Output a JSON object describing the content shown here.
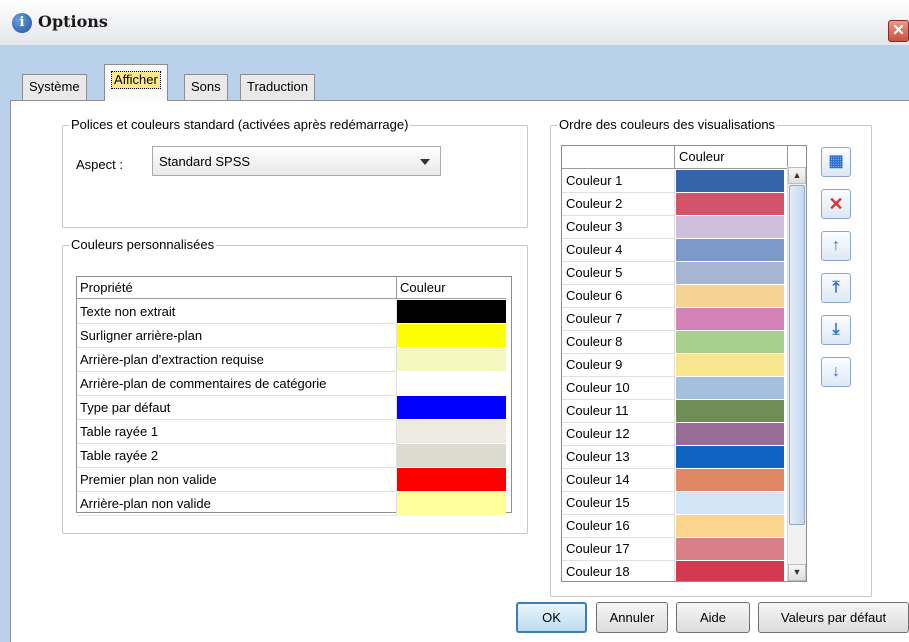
{
  "window": {
    "title": "Options",
    "close_glyph": "✕",
    "logo_glyph": "i"
  },
  "tabs": [
    {
      "label": "Système",
      "active": false
    },
    {
      "label": "Afficher",
      "active": true
    },
    {
      "label": "Sons",
      "active": false
    },
    {
      "label": "Traduction",
      "active": false
    }
  ],
  "fonts_group": {
    "legend": "Polices et couleurs standard (activées après redémarrage)",
    "aspect_label": "Aspect :",
    "aspect_value": "Standard SPSS"
  },
  "custom_colors": {
    "legend": "Couleurs personnalisées",
    "headers": {
      "property": "Propriété",
      "color": "Couleur"
    },
    "rows": [
      {
        "label": "Texte non extrait",
        "color": "#000000"
      },
      {
        "label": "Surligner arrière-plan",
        "color": "#ffff00"
      },
      {
        "label": "Arrière-plan d'extraction requise",
        "color": "#f5f7c0"
      },
      {
        "label": "Arrière-plan de commentaires de catégorie",
        "color": "#ffffff"
      },
      {
        "label": "Type par défaut",
        "color": "#0000ff"
      },
      {
        "label": "Table rayée 1",
        "color": "#eceae1"
      },
      {
        "label": "Table rayée 2",
        "color": "#dcdbd0"
      },
      {
        "label": "Premier plan non valide",
        "color": "#ff0000"
      },
      {
        "label": "Arrière-plan non valide",
        "color": "#ffff99"
      }
    ]
  },
  "viz_order": {
    "legend": "Ordre des couleurs des visualisations",
    "header_color": "Couleur",
    "rows": [
      {
        "label": "Couleur 1",
        "color": "#3465aa"
      },
      {
        "label": "Couleur 2",
        "color": "#d3536b"
      },
      {
        "label": "Couleur 3",
        "color": "#cfbfdd"
      },
      {
        "label": "Couleur 4",
        "color": "#7d99c9"
      },
      {
        "label": "Couleur 5",
        "color": "#a6b6d2"
      },
      {
        "label": "Couleur 6",
        "color": "#f5d394"
      },
      {
        "label": "Couleur 7",
        "color": "#d583b6"
      },
      {
        "label": "Couleur 8",
        "color": "#a8cf8d"
      },
      {
        "label": "Couleur 9",
        "color": "#f8e68f"
      },
      {
        "label": "Couleur 10",
        "color": "#a4c0dd"
      },
      {
        "label": "Couleur 11",
        "color": "#708d55"
      },
      {
        "label": "Couleur 12",
        "color": "#976d95"
      },
      {
        "label": "Couleur 13",
        "color": "#0f64c2"
      },
      {
        "label": "Couleur 14",
        "color": "#df8866"
      },
      {
        "label": "Couleur 15",
        "color": "#d4e4f7"
      },
      {
        "label": "Couleur 16",
        "color": "#fbd58d"
      },
      {
        "label": "Couleur 17",
        "color": "#d87f8a"
      },
      {
        "label": "Couleur 18",
        "color": "#d23a52"
      }
    ],
    "side_buttons": [
      {
        "name": "add-color-button",
        "icon": "add-color-icon",
        "glyph": "▦"
      },
      {
        "name": "delete-color-button",
        "icon": "delete-icon",
        "glyph": "✕"
      },
      {
        "name": "move-up-button",
        "icon": "arrow-up-icon",
        "glyph": "↑"
      },
      {
        "name": "move-top-button",
        "icon": "arrow-top-icon",
        "glyph": "⤒"
      },
      {
        "name": "move-bottom-button",
        "icon": "arrow-bottom-icon",
        "glyph": "⤓"
      },
      {
        "name": "move-down-button",
        "icon": "arrow-down-icon",
        "glyph": "↓"
      }
    ]
  },
  "buttons": {
    "ok": "OK",
    "cancel": "Annuler",
    "help": "Aide",
    "defaults": "Valeurs par défaut"
  }
}
